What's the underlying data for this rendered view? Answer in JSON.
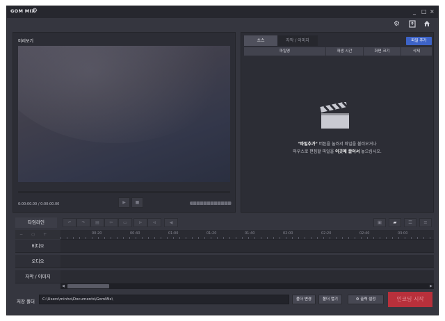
{
  "app": {
    "title": "GOM MIX"
  },
  "window": {
    "minimize": "_",
    "maximize": "□",
    "close": "×"
  },
  "toolbar_icons": [
    "gear-icon",
    "export-icon",
    "home-icon"
  ],
  "preview": {
    "title": "미리보기",
    "timecode": "0:00:00.00 / 0:00:00.00"
  },
  "source_panel": {
    "tabs": [
      "소스",
      "자막 / 이미지"
    ],
    "add_file_label": "파일 추가",
    "columns": [
      "파일명",
      "재생 시간",
      "화면 크기",
      "삭제"
    ],
    "empty_line1_bold": "\"파일추가\"",
    "empty_line1_rest": " 버튼을 눌러서 파일을 불러오거나",
    "empty_line2_pre": "마우스로 편집할 파일을 ",
    "empty_line2_bold": "이곳에 끌어서",
    "empty_line2_post": " 놓으십시오."
  },
  "timeline": {
    "tab_label": "타임라인",
    "ticks": [
      "00:20",
      "00:40",
      "01:00",
      "01:20",
      "01:40",
      "02:00",
      "02:20",
      "02:40",
      "03:00"
    ],
    "tracks": [
      "비디오",
      "오디오",
      "자막 / 이미지"
    ]
  },
  "footer": {
    "save_label": "저장 폴더",
    "save_path": "C:\\Users\\minho\\Documents\\GomMix\\",
    "change_folder": "폴더 변경",
    "open_folder": "폴더 열기",
    "output_settings": "출력 설정",
    "start_encoding": "인코딩 시작"
  },
  "colors": {
    "accent": "#3d63c7",
    "encode": "#b8303b",
    "panel": "#2c2d35",
    "background": "#35363f"
  }
}
